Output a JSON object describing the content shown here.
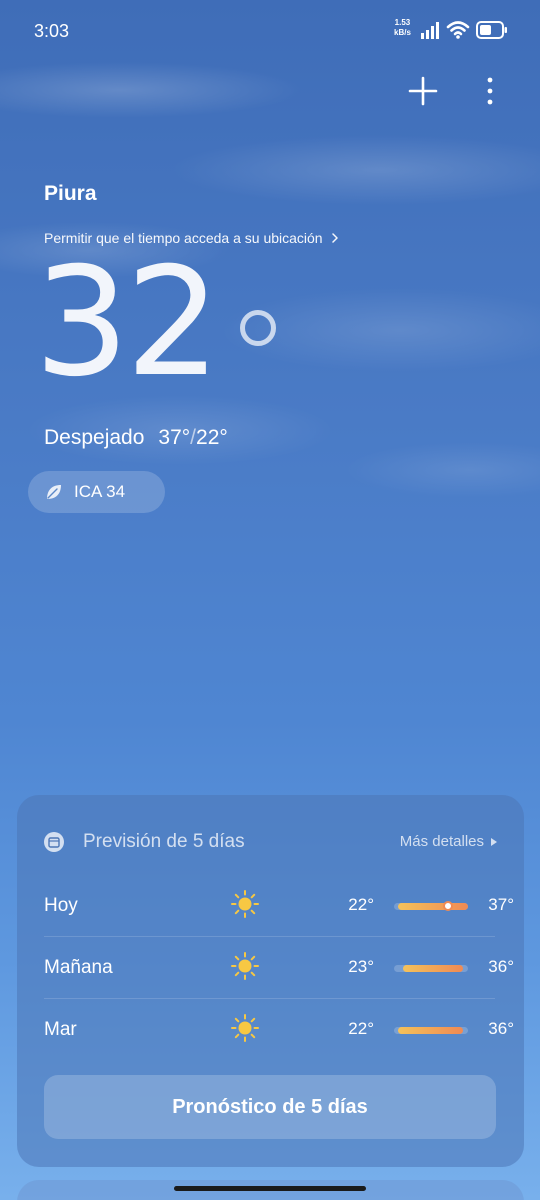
{
  "status": {
    "time": "3:03",
    "net_speed_value": "1.53",
    "net_speed_unit": "kB/s",
    "battery_level": 0.55
  },
  "colors": {
    "sky_top": "#3f6db8",
    "sky_bottom": "#78b0ec",
    "range_bar_start": "#f4c25a",
    "range_bar_end": "#f08a54"
  },
  "location": {
    "city": "Piura",
    "permission_prompt": "Permitir que el tiempo acceda a su ubicación"
  },
  "current": {
    "temperature": "32",
    "condition": "Despejado",
    "high": "37°",
    "low": "22°",
    "aqi_label": "ICA 34"
  },
  "forecast": {
    "title": "Previsión de 5 días",
    "more_label": "Más detalles",
    "button_label": "Pronóstico de 5 días",
    "scale_min": 22,
    "scale_max": 37,
    "days": [
      {
        "name": "Hoy",
        "icon": "sun-icon",
        "low": "22°",
        "high": "37°",
        "low_value": 22,
        "high_value": 37,
        "current_value": 32
      },
      {
        "name": "Mañana",
        "icon": "sun-icon",
        "low": "23°",
        "high": "36°",
        "low_value": 23,
        "high_value": 36
      },
      {
        "name": "Mar",
        "icon": "sun-icon",
        "low": "22°",
        "high": "36°",
        "low_value": 22,
        "high_value": 36
      }
    ]
  },
  "icons": {
    "add": "plus-icon",
    "menu": "more-vertical-icon",
    "location_chevron": "chevron-right-icon",
    "aqi": "leaf-icon",
    "forecast": "calendar-icon",
    "more_details": "triangle-right-icon"
  }
}
